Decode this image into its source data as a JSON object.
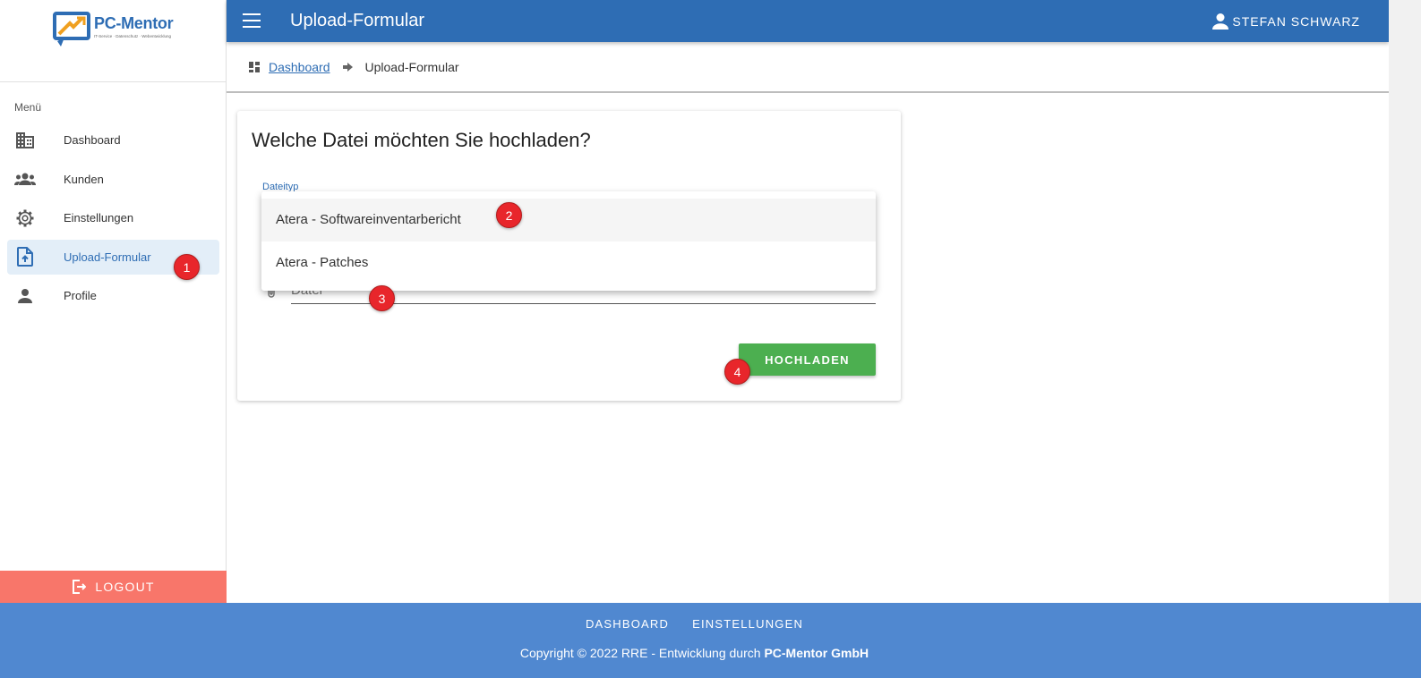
{
  "app": {
    "logo_brand": "PC-Mentor",
    "logo_tagline": "IT-Service · Datenschutz · Webentwicklung"
  },
  "header": {
    "title": "Upload-Formular",
    "user_name": "STEFAN SCHWARZ"
  },
  "sidebar": {
    "menu_label": "Menü",
    "items": [
      {
        "label": "Dashboard",
        "icon": "building-icon"
      },
      {
        "label": "Kunden",
        "icon": "group-icon"
      },
      {
        "label": "Einstellungen",
        "icon": "gear-icon"
      },
      {
        "label": "Upload-Formular",
        "icon": "file-upload-icon",
        "active": true
      },
      {
        "label": "Profile",
        "icon": "person-icon"
      }
    ],
    "logout_label": "LOGOUT"
  },
  "breadcrumb": {
    "link": "Dashboard",
    "current": "Upload-Formular"
  },
  "form": {
    "title": "Welche Datei möchten Sie hochladen?",
    "filetype_label": "Dateityp",
    "file_placeholder": "Datei",
    "submit_label": "HOCHLADEN"
  },
  "dropdown": {
    "options": [
      "Atera - Softwareinventarbericht",
      "Atera - Patches"
    ]
  },
  "annotations": [
    "1",
    "2",
    "3",
    "4"
  ],
  "footer": {
    "links": [
      "DASHBOARD",
      "EINSTELLUNGEN"
    ],
    "copyright_prefix": "Copyright © 2022 RRE - Entwicklung durch",
    "copyright_company": "PC-Mentor GmbH"
  },
  "colors": {
    "primary": "#2e6db4",
    "footer": "#5088d0",
    "logout": "#f8766a",
    "success": "#4caf50",
    "badge": "#e8262b"
  }
}
